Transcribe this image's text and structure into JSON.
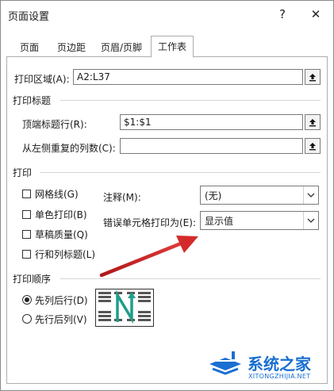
{
  "window": {
    "title": "页面设置",
    "help_label": "?",
    "close_label": "✕"
  },
  "tabs": [
    {
      "label": "页面"
    },
    {
      "label": "页边距"
    },
    {
      "label": "页眉/页脚"
    },
    {
      "label": "工作表"
    }
  ],
  "print_area": {
    "label": "打印区域(A):",
    "value": "A2:L37"
  },
  "print_titles": {
    "heading": "打印标题",
    "rows_label": "顶端标题行(R):",
    "rows_value": "$1:$1",
    "cols_label": "从左侧重复的列数(C):",
    "cols_value": ""
  },
  "print": {
    "heading": "打印",
    "gridlines_label": "网格线(G)",
    "mono_label": "单色打印(B)",
    "draft_label": "草稿质量(Q)",
    "headings_label": "行和列标题(L)",
    "comments_label": "注释(M):",
    "comments_value": "(无)",
    "errors_label": "错误单元格打印为(E):",
    "errors_value": "显示值"
  },
  "page_order": {
    "heading": "打印顺序",
    "down_then_over": "先列后行(D)",
    "over_then_down": "先行后列(V)",
    "selected": "down_then_over"
  },
  "watermark": {
    "brand": "系统之家",
    "domain": "XITONGZHIJIA.NET"
  },
  "colors": {
    "arrow": "#d42a2a",
    "order_arrow": "#1f9e8a",
    "brand": "#1a6fd1"
  },
  "icons": {
    "collapse": "collapse-dialog-icon",
    "dropdown": "chevron-down-icon"
  }
}
